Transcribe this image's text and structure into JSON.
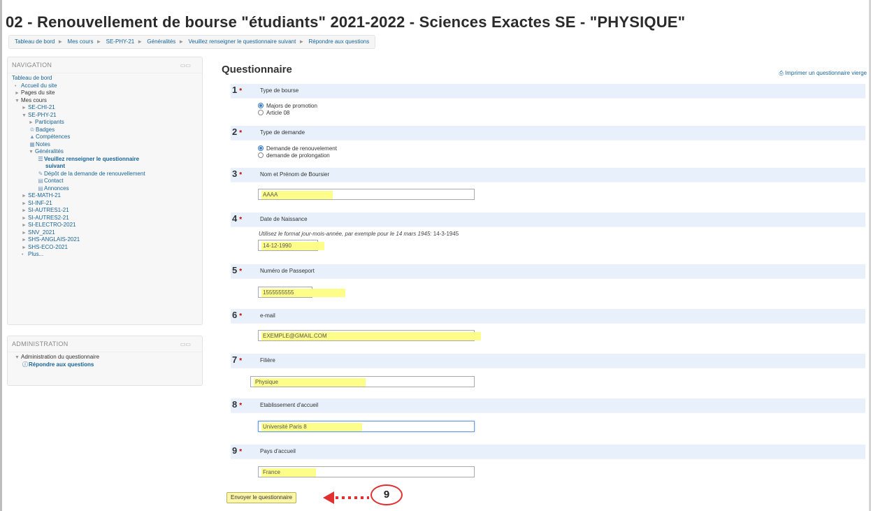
{
  "page_title": "02 - Renouvellement de bourse \"étudiants\" 2021-2022 - Sciences Exactes SE - \"PHYSIQUE\"",
  "breadcrumb": [
    "Tableau de bord",
    "Mes cours",
    "SE-PHY-21",
    "Généralités",
    "Veuillez renseigner le questionnaire suivant",
    "Répondre aux questions"
  ],
  "navigation": {
    "title": "NAVIGATION",
    "dashboard": "Tableau de bord",
    "site_home": "Accueil du site",
    "site_pages": "Pages du site",
    "my_courses": "Mes cours",
    "course_1": "SE-CHI-21",
    "course_2": "SE-PHY-21",
    "participants": "Participants",
    "badges": "Badges",
    "competences": "Compétences",
    "notes": "Notes",
    "generalites": "Généralités",
    "questionnaire_link": "Veuillez renseigner le questionnaire",
    "questionnaire_link_2": "suivant",
    "depot": "Dépôt de la demande de renouvellement",
    "contact": "Contact",
    "annonces": "Annonces",
    "courses_more": [
      "SE-MATH-21",
      "SI-INF-21",
      "SI-AUTRES1-21",
      "SI-AUTRES2-21",
      "SI-ELECTRO-2021",
      "SNV_2021",
      "SHS-ANGLAIS-2021",
      "SHS-ECO-2021"
    ],
    "plus": "Plus..."
  },
  "administration": {
    "title": "ADMINISTRATION",
    "item": "Administration du questionnaire",
    "sub": "Répondre aux questions"
  },
  "questionnaire": {
    "title": "Questionnaire",
    "print_link": "Imprimer un questionnaire vierge",
    "q1": {
      "num": "1",
      "label": "Type de bourse",
      "options": [
        "Majors de promotion",
        "Article 08"
      ]
    },
    "q2": {
      "num": "2",
      "label": "Type de demande",
      "options": [
        "Demande de renouvelement",
        "demande de prolongation"
      ]
    },
    "q3": {
      "num": "3",
      "label": "Nom et Prénom de Boursier",
      "value": "AAAA"
    },
    "q4": {
      "num": "4",
      "label": "Date de Naissance",
      "hint": "Utilisez le format jour-mois-année, par exemple pour le 14 mars 1945:",
      "hint_example": "14-3-1945",
      "value": "14-12-1990"
    },
    "q5": {
      "num": "5",
      "label": "Numéro de Passeport",
      "value": "1555555555"
    },
    "q6": {
      "num": "6",
      "label": "e-mail",
      "value": "EXEMPLE@GMAIL.COM"
    },
    "q7": {
      "num": "7",
      "label": "Filière",
      "value": "Physique"
    },
    "q8": {
      "num": "8",
      "label": "Etablissement d'accueil",
      "value": "Université Paris 8"
    },
    "q9": {
      "num": "9",
      "label": "Pays d'accueil",
      "value": "France"
    },
    "required_mark": "*",
    "submit": "Envoyer le questionnaire"
  },
  "annotation": {
    "step": "9",
    "color": "#e03030"
  }
}
